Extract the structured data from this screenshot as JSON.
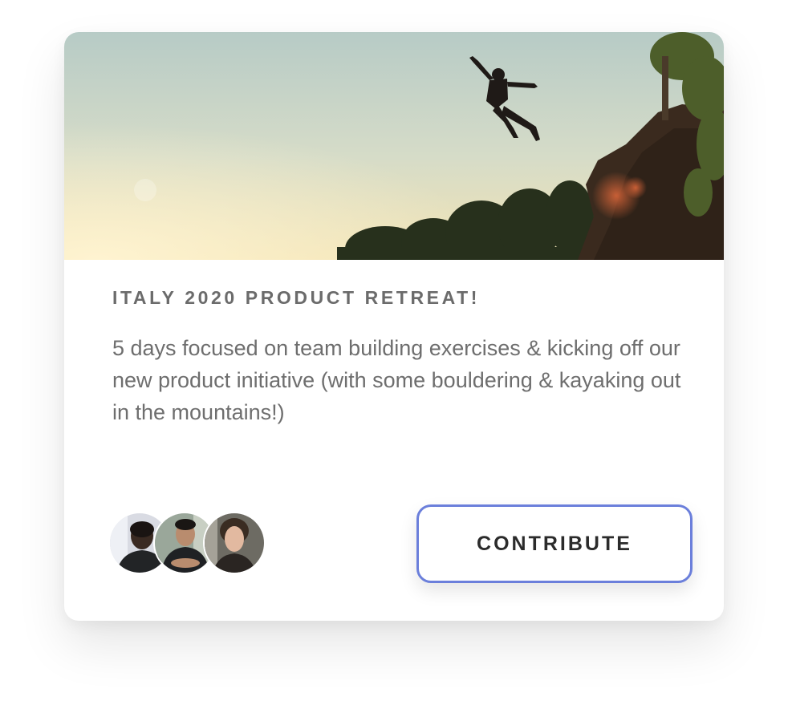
{
  "card": {
    "title": "ITALY 2020 PRODUCT RETREAT!",
    "description": "5 days focused on team building exercises & kicking off our new product initiative (with some bouldering & kayaking out in the mountains!)",
    "button_label": "CONTRIBUTE",
    "hero_image": "cliff-jumper-sunset-photo",
    "avatars": [
      {
        "name": "avatar-1"
      },
      {
        "name": "avatar-2"
      },
      {
        "name": "avatar-3"
      }
    ]
  },
  "colors": {
    "button_border": "#6b7fdb",
    "title": "#6b6b6b",
    "text": "#6e6e6e"
  }
}
